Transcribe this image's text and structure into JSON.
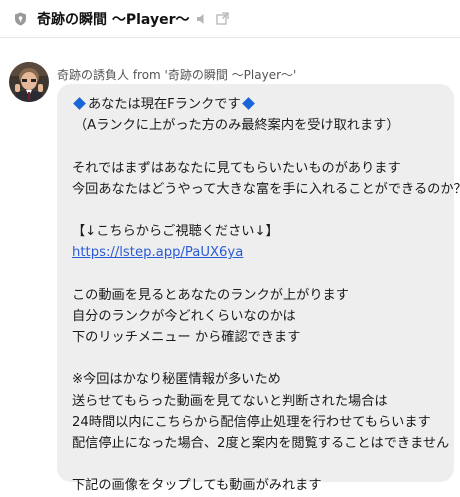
{
  "header": {
    "title": "奇跡の瞬間 〜Player〜",
    "icons": [
      "shield-icon",
      "speaker-mute-icon",
      "external-link-icon"
    ]
  },
  "message": {
    "sender": "奇跡の誘負人 from '奇跡の瞬間 〜Player〜'",
    "line1_text": "あなたは現在Fランクです",
    "line2": "（Aランクに上がった方のみ最終案内を受け取れます）",
    "line3": "それではまずはあなたに見てもらいたいものがあります",
    "line4": "今回あなたはどうやって大きな富を手に入れることができるのか？",
    "line5": "【↓こちらからご視聴ください↓】",
    "link": "https://lstep.app/PaUX6ya",
    "line6": "この動画を見るとあなたのランクが上がります",
    "line7": "自分のランクが今どれくらいなのかは",
    "line8": "下のリッチメニュー から確認できます",
    "line9": "※今回はかなり秘匿情報が多いため",
    "line10": "送らせてもらった動画を見てないと判断された場合は",
    "line11": "24時間以内にこちらから配信停止処理を行わせてもらいます",
    "line12": "配信停止になった場合、2度と案内を閲覧することはできません",
    "line13": "下記の画像をタップしても動画がみれます"
  },
  "colors": {
    "bubble": "#eeeeef",
    "link": "#2a5bd7",
    "diamond": "#1a66d8"
  }
}
